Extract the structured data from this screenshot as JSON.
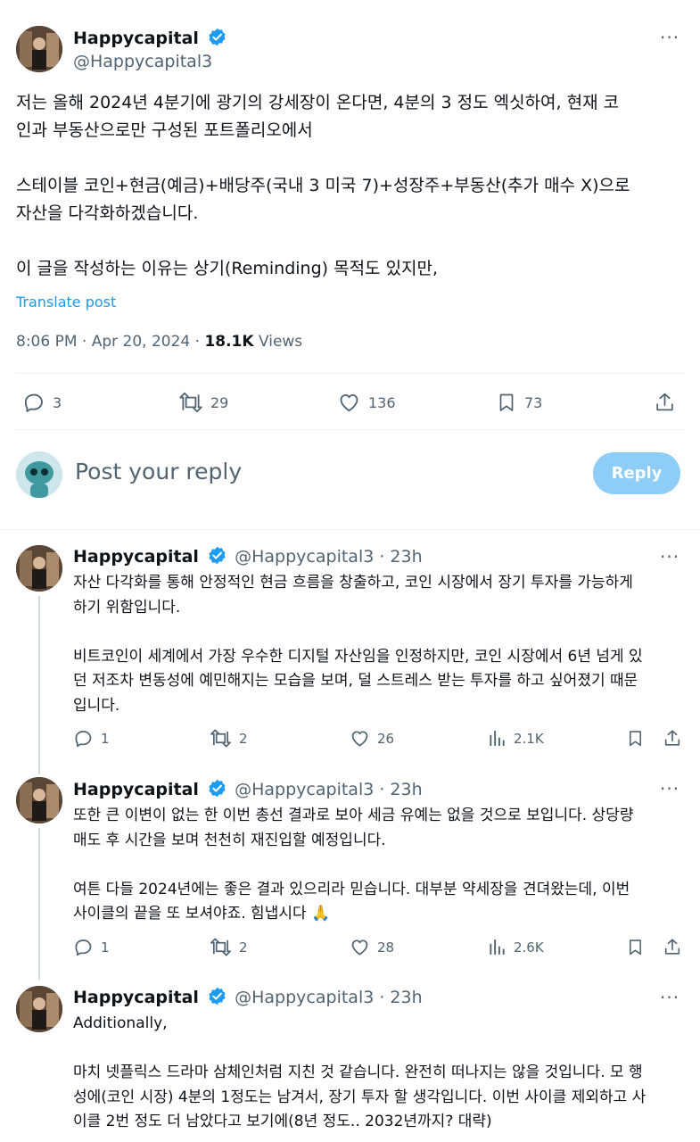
{
  "main_tweet": {
    "author_name": "Happycapital",
    "author_handle": "@Happycapital3",
    "more": "···",
    "text": "저는 올해 2024년 4분기에 광기의 강세장이 온다면, 4분의 3 정도 엑싯하여, 현재 코\n인과 부동산으로만 구성된 포트폴리오에서\n\n스테이블 코인+현금(예금)+배당주(국내 3 미국 7)+성장주+부동산(추가 매수 X)으로\n자산을 다각화하겠습니다.\n\n이 글을 작성하는 이유는 상기(Reminding) 목적도 있지만,",
    "translate": "Translate post",
    "time": "8:06 PM · Apr 20, 2024 · ",
    "views_count": "18.1K",
    "views_label": " Views",
    "replies": "3",
    "reposts": "29",
    "likes": "136",
    "bookmarks": "73"
  },
  "compose": {
    "placeholder": "Post your reply",
    "button": "Reply"
  },
  "replies": [
    {
      "author_name": "Happycapital",
      "author_meta": "@Happycapital3 · 23h",
      "more": "···",
      "text": "자산 다각화를 통해 안정적인 현금 흐름을 창출하고, 코인 시장에서 장기 투자를 가능하게\n하기 위함입니다.\n\n비트코인이 세계에서 가장 우수한 디지털 자산임을 인정하지만, 코인 시장에서 6년 넘게 있\n던 저조차 변동성에 예민해지는 모습을 보며, 덜 스트레스 받는 투자를 하고 싶어졌기 때문\n입니다.",
      "replies": "1",
      "reposts": "2",
      "likes": "26",
      "views": "2.1K"
    },
    {
      "author_name": "Happycapital",
      "author_meta": "@Happycapital3 · 23h",
      "more": "···",
      "text": "또한 큰 이변이 없는 한 이번 총선 결과로 보아 세금 유예는 없을 것으로 보입니다. 상당량\n매도 후 시간을 보며 천천히 재진입할 예정입니다.\n\n여튼 다들 2024년에는 좋은 결과 있으리라 믿습니다. 대부분 약세장을 견뎌왔는데, 이번\n사이클의 끝을 또 보셔야죠. 힘냅시다 🙏",
      "replies": "1",
      "reposts": "2",
      "likes": "28",
      "views": "2.6K"
    },
    {
      "author_name": "Happycapital",
      "author_meta": "@Happycapital3 · 23h",
      "more": "···",
      "text": "Additionally,\n\n마치 넷플릭스 드라마 삼체인처럼 지친 것 같습니다. 완전히 떠나지는 않을 것입니다. 모 행\n성에(코인 시장) 4분의 1정도는 남겨서, 장기 투자 할 생각입니다. 이번 사이클 제외하고 사\n이클 2번 정도 더 남았다고 보기에(8년 정도.. 2032년까지? 대략)"
    }
  ],
  "colors": {
    "accent": "#1d9bf0",
    "reply_button": "#8ecdf8",
    "muted": "#536471",
    "text": "#0f1419"
  }
}
